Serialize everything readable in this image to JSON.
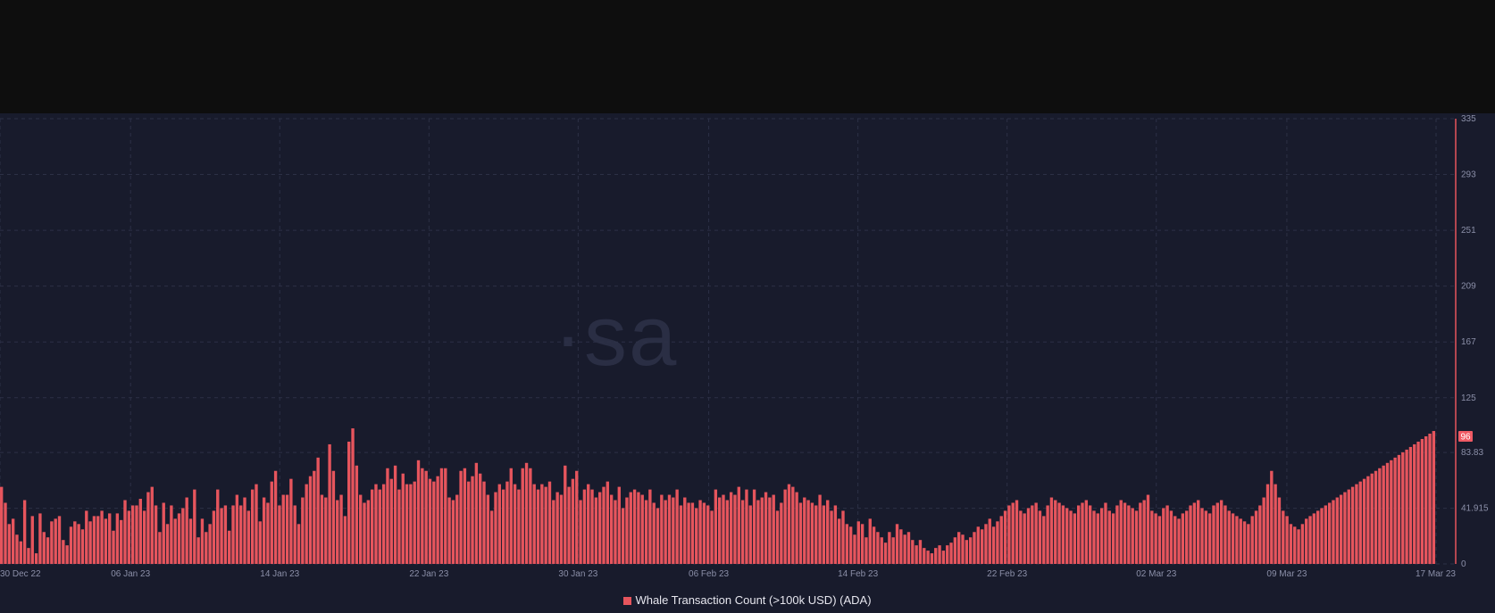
{
  "watermark": "·sa",
  "legend": {
    "label": "Whale Transaction Count (>100k USD) (ADA)"
  },
  "colors": {
    "bar": "#e6555d",
    "bar_edge": "#ffb0b4",
    "grid": "#2c3046",
    "axis_text": "#8b8fa8",
    "marker_bg": "#f05a64",
    "marker_text": "#ffffff"
  },
  "chart_data": {
    "type": "bar",
    "title": "",
    "xlabel": "",
    "ylabel": "",
    "ylim": [
      0,
      335
    ],
    "yticks": [
      0,
      41.915,
      83.83,
      125,
      167,
      209,
      251,
      293,
      335
    ],
    "xlim": [
      "2022-12-30",
      "2023-03-17"
    ],
    "x_tick_labels": [
      {
        "date": "2022-12-30",
        "label": "30 Dec 22"
      },
      {
        "date": "2023-01-06",
        "label": "06 Jan 23"
      },
      {
        "date": "2023-01-14",
        "label": "14 Jan 23"
      },
      {
        "date": "2023-01-22",
        "label": "22 Jan 23"
      },
      {
        "date": "2023-01-30",
        "label": "30 Jan 23"
      },
      {
        "date": "2023-02-06",
        "label": "06 Feb 23"
      },
      {
        "date": "2023-02-14",
        "label": "14 Feb 23"
      },
      {
        "date": "2023-02-22",
        "label": "22 Feb 23"
      },
      {
        "date": "2023-03-02",
        "label": "02 Mar 23"
      },
      {
        "date": "2023-03-09",
        "label": "09 Mar 23"
      },
      {
        "date": "2023-03-17",
        "label": "17 Mar 23"
      }
    ],
    "current_value": {
      "value": 96,
      "label": "96"
    },
    "grid": true,
    "legend_position": "bottom-center",
    "series": [
      {
        "name": "Whale Transaction Count (>100k USD) (ADA)",
        "values": [
          58,
          46,
          30,
          34,
          22,
          17,
          48,
          12,
          36,
          8,
          38,
          24,
          20,
          32,
          34,
          36,
          18,
          14,
          28,
          32,
          30,
          26,
          40,
          32,
          36,
          36,
          40,
          34,
          38,
          25,
          38,
          33,
          48,
          40,
          44,
          44,
          49,
          40,
          54,
          58,
          44,
          24,
          46,
          30,
          44,
          34,
          38,
          42,
          50,
          34,
          56,
          20,
          34,
          24,
          30,
          40,
          56,
          42,
          44,
          25,
          44,
          52,
          44,
          50,
          40,
          56,
          60,
          32,
          50,
          46,
          62,
          70,
          44,
          52,
          52,
          64,
          44,
          30,
          50,
          60,
          66,
          70,
          80,
          52,
          50,
          90,
          70,
          48,
          52,
          36,
          92,
          102,
          74,
          52,
          46,
          48,
          56,
          60,
          56,
          60,
          72,
          64,
          74,
          56,
          68,
          60,
          60,
          62,
          78,
          72,
          70,
          64,
          62,
          66,
          72,
          72,
          50,
          48,
          52,
          70,
          72,
          62,
          66,
          76,
          68,
          62,
          52,
          40,
          54,
          60,
          56,
          62,
          72,
          60,
          56,
          72,
          76,
          72,
          60,
          56,
          60,
          58,
          62,
          48,
          54,
          52,
          74,
          58,
          64,
          70,
          48,
          56,
          60,
          56,
          50,
          54,
          58,
          62,
          52,
          48,
          58,
          42,
          50,
          54,
          56,
          54,
          52,
          48,
          56,
          46,
          42,
          52,
          48,
          52,
          50,
          56,
          44,
          50,
          46,
          46,
          42,
          48,
          46,
          44,
          40,
          56,
          50,
          52,
          48,
          54,
          52,
          58,
          48,
          56,
          44,
          56,
          48,
          50,
          54,
          50,
          52,
          40,
          46,
          56,
          60,
          58,
          54,
          46,
          50,
          48,
          46,
          44,
          52,
          44,
          48,
          40,
          44,
          34,
          40,
          30,
          28,
          22,
          32,
          30,
          20,
          34,
          28,
          24,
          20,
          16,
          24,
          20,
          30,
          26,
          22,
          24,
          18,
          14,
          18,
          12,
          10,
          8,
          12,
          14,
          10,
          14,
          16,
          20,
          24,
          22,
          18,
          20,
          24,
          28,
          26,
          30,
          34,
          28,
          32,
          36,
          40,
          44,
          46,
          48,
          40,
          38,
          42,
          44,
          46,
          40,
          36,
          44,
          50,
          48,
          46,
          44,
          42,
          40,
          38,
          44,
          46,
          48,
          44,
          40,
          38,
          42,
          46,
          40,
          38,
          44,
          48,
          46,
          44,
          42,
          40,
          46,
          48,
          52,
          40,
          38,
          36,
          42,
          44,
          40,
          36,
          34,
          38,
          40,
          44,
          46,
          48,
          42,
          40,
          38,
          44,
          46,
          48,
          44,
          40,
          38,
          36,
          34,
          32,
          30,
          36,
          40,
          44,
          50,
          60,
          70,
          60,
          50,
          40,
          36,
          30,
          28,
          26,
          30,
          34,
          36,
          38,
          40,
          42,
          44,
          46,
          48,
          50,
          52,
          54,
          56,
          58,
          60,
          62,
          64,
          66,
          68,
          70,
          72,
          74,
          76,
          78,
          80,
          82,
          84,
          86,
          88,
          90,
          92,
          94,
          96,
          98,
          100
        ]
      }
    ]
  }
}
